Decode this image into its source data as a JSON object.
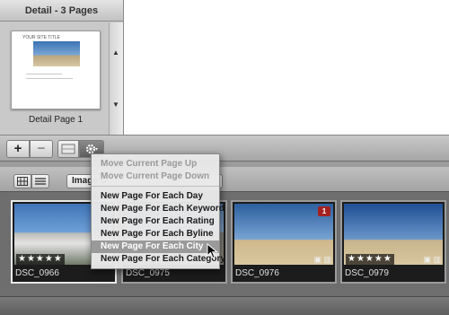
{
  "pages_panel": {
    "title": "Detail - 3 Pages",
    "thumbnail_title": "YOUR SITE TITLE",
    "page_label": "Detail Page 1"
  },
  "toolbar": {
    "add_label": "+",
    "remove_label": "−",
    "layout_icon": "layout-icon",
    "action_icon": "gear-icon"
  },
  "browser": {
    "filter_value": "Image O",
    "view_grid_icon": "grid-view-icon",
    "view_list_icon": "list-view-icon",
    "photos": [
      {
        "name": "DSC_0966",
        "rating": "★★★★★",
        "selected": true
      },
      {
        "name": "DSC_0975",
        "rating": "",
        "selected": false
      },
      {
        "name": "DSC_0976",
        "rating": "",
        "badge": "1",
        "selected": false
      },
      {
        "name": "DSC_0979",
        "rating": "★★★★★",
        "selected": false
      }
    ]
  },
  "context_menu": {
    "items": [
      {
        "label": "Move Current Page Up",
        "enabled": false
      },
      {
        "label": "Move Current Page Down",
        "enabled": false
      },
      {
        "label": "New Page For Each Day",
        "enabled": true
      },
      {
        "label": "New Page For Each Keyword",
        "enabled": true
      },
      {
        "label": "New Page For Each Rating",
        "enabled": true
      },
      {
        "label": "New Page For Each Byline",
        "enabled": true
      },
      {
        "label": "New Page For Each City",
        "enabled": true,
        "highlighted": true
      },
      {
        "label": "New Page For Each Category",
        "enabled": true
      }
    ]
  },
  "colors": {
    "menu_highlight": "#9a9a9a",
    "badge_red": "#a42121",
    "browser_bg": "#6e6e6e"
  }
}
